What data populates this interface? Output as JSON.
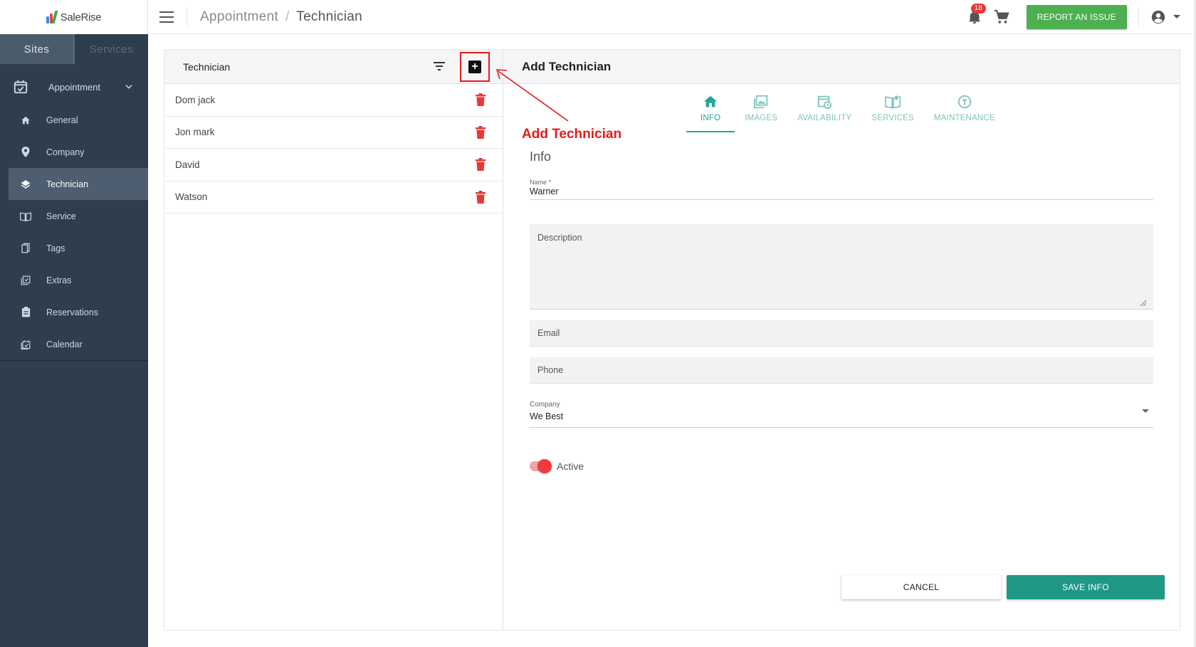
{
  "app": {
    "logo_text": "SaleRise"
  },
  "sidebar": {
    "tabs": [
      {
        "label": "Sites"
      },
      {
        "label": "Services"
      }
    ],
    "group": {
      "label": "Appointment"
    },
    "items": [
      {
        "label": "General",
        "icon": "home-icon"
      },
      {
        "label": "Company",
        "icon": "location-pin-icon"
      },
      {
        "label": "Technician",
        "icon": "layers-icon"
      },
      {
        "label": "Service",
        "icon": "book-icon"
      },
      {
        "label": "Tags",
        "icon": "tag-icon"
      },
      {
        "label": "Extras",
        "icon": "extras-icon"
      },
      {
        "label": "Reservations",
        "icon": "reservations-icon"
      },
      {
        "label": "Calendar",
        "icon": "calendar-icon"
      }
    ]
  },
  "header": {
    "breadcrumb": {
      "parent": "Appointment",
      "separator": "/",
      "current": "Technician"
    },
    "notification_count": "18",
    "report_label": "REPORT AN ISSUE"
  },
  "technician_list": {
    "title": "Technician",
    "rows": [
      {
        "name": "Dom jack"
      },
      {
        "name": "Jon mark"
      },
      {
        "name": "David"
      },
      {
        "name": "Watson"
      }
    ]
  },
  "add_panel": {
    "title": "Add Technician",
    "tabs": [
      {
        "label": "INFO",
        "icon": "home-icon"
      },
      {
        "label": "IMAGES",
        "icon": "image-icon"
      },
      {
        "label": "AVAILABILITY",
        "icon": "availability-icon"
      },
      {
        "label": "SERVICES",
        "icon": "book-open-icon"
      },
      {
        "label": "MAINTENANCE",
        "icon": "maintenance-icon"
      }
    ],
    "form": {
      "section_title": "Info",
      "name_label": "Name *",
      "name_value": "Warner",
      "description_placeholder": "Description",
      "email_placeholder": "Email",
      "phone_placeholder": "Phone",
      "company_label": "Company",
      "company_value": "We Best",
      "active_label": "Active",
      "active": true
    },
    "buttons": {
      "cancel": "CANCEL",
      "save": "SAVE INFO"
    }
  },
  "annotation": {
    "text": "Add Technician",
    "color": "#e31b1b"
  },
  "colors": {
    "accent": "#26a69a",
    "save": "#1f9885",
    "report": "#4caf50",
    "sidebar": "#2e3e4e",
    "delete": "#e53935"
  }
}
